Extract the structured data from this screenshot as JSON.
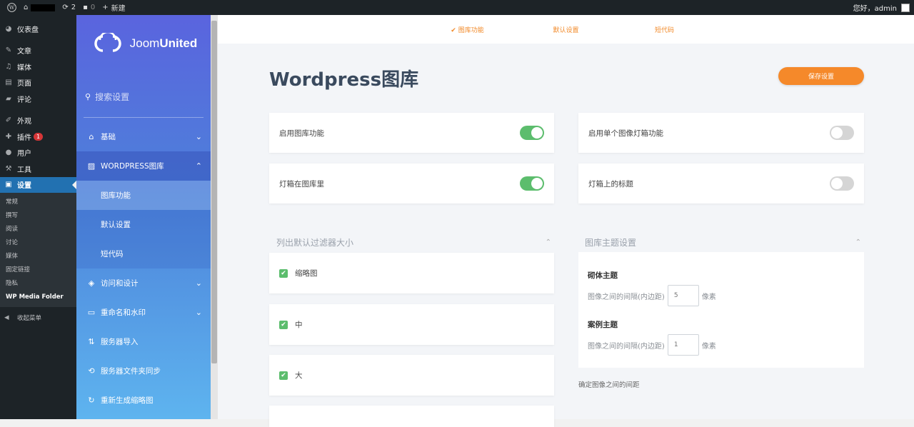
{
  "adminbar": {
    "updates_count": "2",
    "comments_count": "0",
    "new_label": "新建",
    "greeting": "您好，admin"
  },
  "wp_menu": {
    "items": [
      {
        "label": "仪表盘",
        "icon": "dashboard-icon"
      },
      {
        "label": "文章",
        "icon": "pin-icon"
      },
      {
        "label": "媒体",
        "icon": "media-icon"
      },
      {
        "label": "页面",
        "icon": "page-icon"
      },
      {
        "label": "评论",
        "icon": "comment-icon"
      },
      {
        "label": "外观",
        "icon": "brush-icon"
      },
      {
        "label": "插件",
        "icon": "plugin-icon",
        "badge": "1"
      },
      {
        "label": "用户",
        "icon": "user-icon"
      },
      {
        "label": "工具",
        "icon": "wrench-icon"
      },
      {
        "label": "设置",
        "icon": "settings-icon"
      }
    ],
    "submenu": [
      "常规",
      "撰写",
      "阅读",
      "讨论",
      "媒体",
      "固定链接",
      "隐私",
      "WP Media Folder"
    ],
    "collapse_label": "收起菜单"
  },
  "plugin_sidebar": {
    "logo_text_light": "Joom",
    "logo_text_bold": "United",
    "search_placeholder": "搜索设置",
    "nav": [
      {
        "label": "基础",
        "icon": "home-icon"
      },
      {
        "label": "WORDPRESS图库",
        "icon": "image-icon"
      },
      {
        "label": "图库功能"
      },
      {
        "label": "默认设置"
      },
      {
        "label": "短代码"
      },
      {
        "label": "访问和设计",
        "icon": "paint-bucket-icon"
      },
      {
        "label": "重命名和水印",
        "icon": "watermark-icon"
      },
      {
        "label": "服务器导入",
        "icon": "import-icon"
      },
      {
        "label": "服务器文件夹同步",
        "icon": "sync-icon"
      },
      {
        "label": "重新生成缩略图",
        "icon": "regenerate-icon"
      }
    ]
  },
  "tabs": [
    "图库功能",
    "默认设置",
    "短代码"
  ],
  "page": {
    "title": "Wordpress图库",
    "save_label": "保存设置"
  },
  "toggles": [
    {
      "label": "启用图库功能",
      "on": true
    },
    {
      "label": "启用单个图像灯箱功能",
      "on": false
    },
    {
      "label": "灯箱在图库里",
      "on": true
    },
    {
      "label": "灯箱上的标题",
      "on": false
    }
  ],
  "filter_section": {
    "heading": "列出默认过滤器大小",
    "options": [
      {
        "label": "缩略图",
        "checked": true
      },
      {
        "label": "中",
        "checked": true
      },
      {
        "label": "大",
        "checked": true
      }
    ]
  },
  "theme_section": {
    "heading": "图库主题设置",
    "themes": [
      {
        "name": "砌体主题",
        "desc": "图像之间的间隔(内边距)",
        "value": "5",
        "unit": "像素"
      },
      {
        "name": "案例主题",
        "desc": "图像之间的间隔(内边距)",
        "value": "1",
        "unit": "像素"
      }
    ],
    "note": "确定图像之间的间距"
  },
  "colors": {
    "accent": "#f5892a",
    "toggle_on": "#5cbd6d",
    "wp_active": "#2271b1"
  }
}
